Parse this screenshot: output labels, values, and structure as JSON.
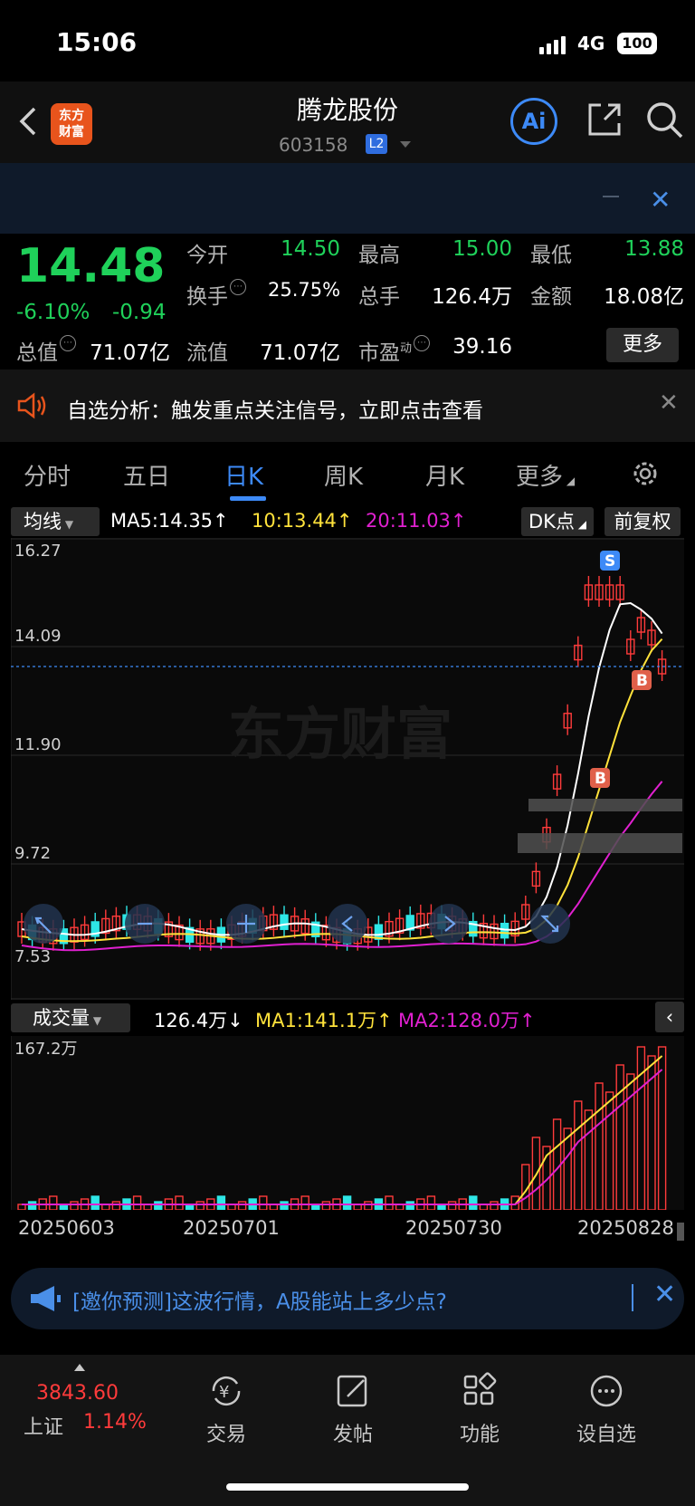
{
  "status": {
    "time": "15:06",
    "network": "4G",
    "battery": "100"
  },
  "header": {
    "logo_line1": "东方",
    "logo_line2": "财富",
    "title": "腾龙股份",
    "code": "603158",
    "level_badge": "L2"
  },
  "quote": {
    "price": "14.48",
    "change_pct": "-6.10%",
    "change": "-0.94",
    "open_label": "今开",
    "open": "14.50",
    "high_label": "最高",
    "high": "15.00",
    "low_label": "最低",
    "low": "13.88",
    "turnover_label": "换手",
    "turnover": "25.75%",
    "volume_label": "总手",
    "volume": "126.4万",
    "amount_label": "金额",
    "amount": "18.08亿",
    "mcap_label": "总值",
    "mcap": "71.07亿",
    "float_label": "流值",
    "float": "71.07亿",
    "pe_label": "市盈",
    "pe_sup": "动",
    "pe": "39.16",
    "more": "更多"
  },
  "notice": {
    "text": "自选分析：触发重点关注信号，立即点击查看"
  },
  "tabs": [
    "分时",
    "五日",
    "日K",
    "周K",
    "月K",
    "更多"
  ],
  "active_tab": "日K",
  "ma_row": {
    "selector": "均线",
    "ma5": "MA5:14.35↑",
    "ma10": "10:13.44↑",
    "ma20": "20:11.03↑",
    "dk": "DK点",
    "adjust": "前复权"
  },
  "price_axis": [
    "16.27",
    "14.09",
    "11.90",
    "9.72",
    "7.53"
  ],
  "watermark": "东方财富",
  "vol_row": {
    "selector": "成交量",
    "vol": "126.4万↓",
    "ma1": "MA1:141.1万↑",
    "ma2": "MA2:128.0万↑",
    "axis_max": "167.2万"
  },
  "dates": [
    "20250603",
    "20250701",
    "20250730",
    "20250828"
  ],
  "promo": {
    "text": "[邀你预测]这波行情，A股能站上多少点?"
  },
  "bottom_nav": {
    "index_value": "3843.60",
    "index_name": "上证",
    "index_pct": "1.14%",
    "items": [
      "交易",
      "发帖",
      "功能",
      "设自选"
    ]
  },
  "colors": {
    "up": "#ff3b3b",
    "down": "#2ee6e6",
    "ma5": "#ffffff",
    "ma10": "#ffe23b",
    "ma20": "#e020d0",
    "accent": "#3d8af7"
  },
  "markers": {
    "buy": "B",
    "sell": "S"
  }
}
